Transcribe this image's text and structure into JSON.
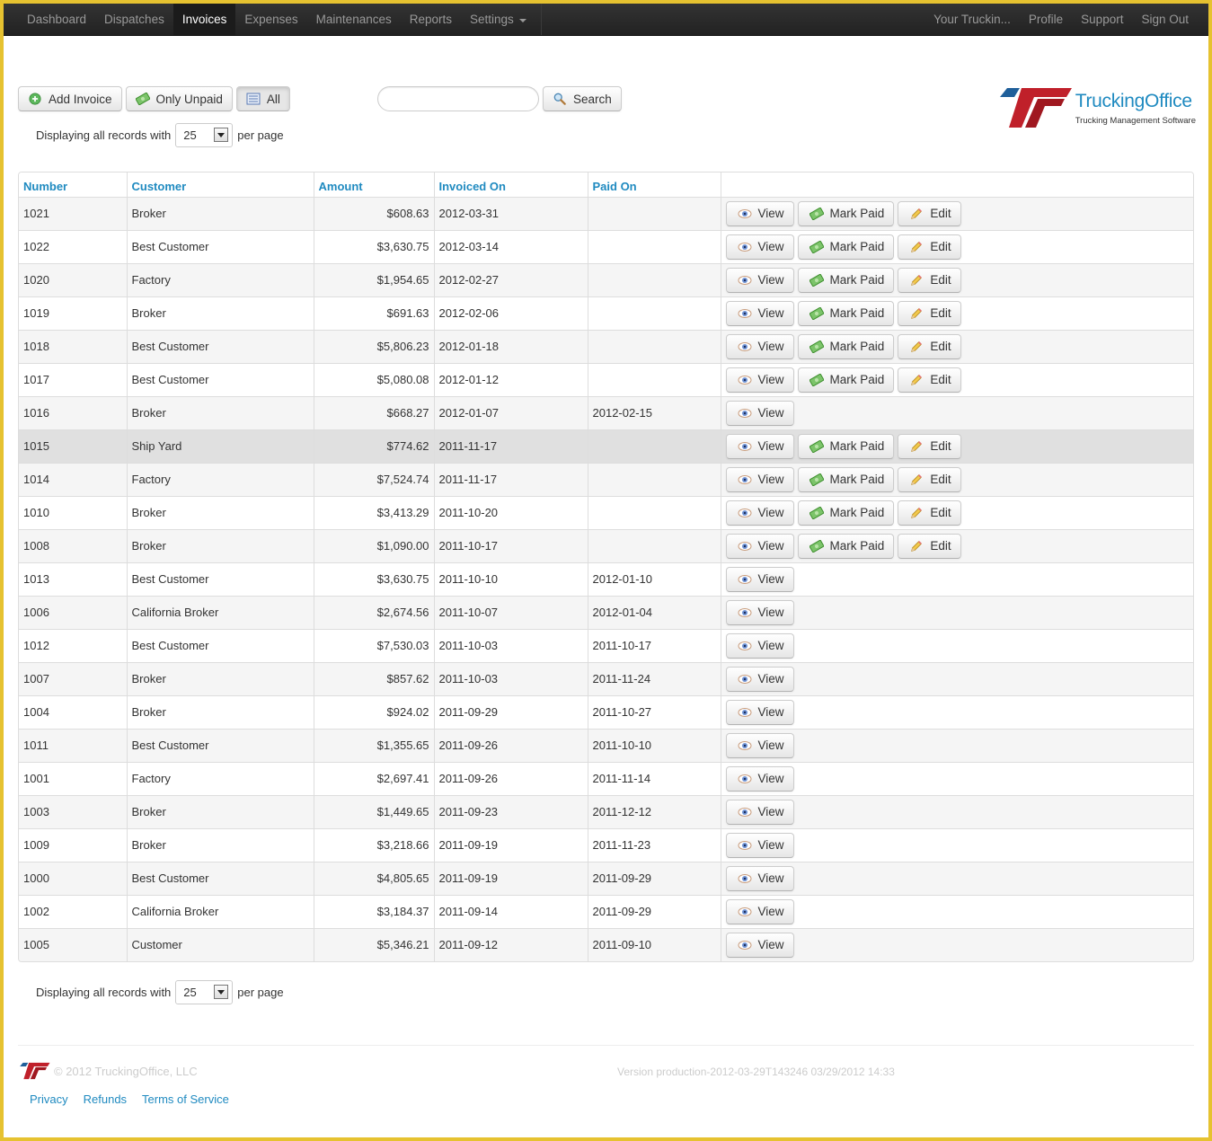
{
  "nav": {
    "left": [
      {
        "label": "Dashboard",
        "active": false
      },
      {
        "label": "Dispatches",
        "active": false
      },
      {
        "label": "Invoices",
        "active": true
      },
      {
        "label": "Expenses",
        "active": false
      },
      {
        "label": "Maintenances",
        "active": false
      },
      {
        "label": "Reports",
        "active": false
      },
      {
        "label": "Settings",
        "active": false,
        "dropdown": true
      }
    ],
    "right": [
      {
        "label": "Your Truckin..."
      },
      {
        "label": "Profile"
      },
      {
        "label": "Support"
      },
      {
        "label": "Sign Out"
      }
    ]
  },
  "toolbar": {
    "add_invoice_label": "Add Invoice",
    "only_unpaid_label": "Only Unpaid",
    "all_label": "All",
    "search_value": "",
    "search_label": "Search"
  },
  "logo": {
    "title": "TruckingOffice",
    "subtitle": "Trucking Management Software"
  },
  "pagination": {
    "prefix": "Displaying all records with",
    "per_page_value": "25",
    "suffix": "per page"
  },
  "table": {
    "columns": [
      "Number",
      "Customer",
      "Amount",
      "Invoiced On",
      "Paid On",
      ""
    ],
    "action_labels": {
      "view": "View",
      "mark_paid": "Mark Paid",
      "edit": "Edit"
    },
    "rows": [
      {
        "number": "1021",
        "customer": "Broker",
        "amount": "$608.63",
        "invoiced_on": "2012-03-31",
        "paid_on": "",
        "actions": [
          "view",
          "mark_paid",
          "edit"
        ]
      },
      {
        "number": "1022",
        "customer": "Best Customer",
        "amount": "$3,630.75",
        "invoiced_on": "2012-03-14",
        "paid_on": "",
        "actions": [
          "view",
          "mark_paid",
          "edit"
        ]
      },
      {
        "number": "1020",
        "customer": "Factory",
        "amount": "$1,954.65",
        "invoiced_on": "2012-02-27",
        "paid_on": "",
        "actions": [
          "view",
          "mark_paid",
          "edit"
        ]
      },
      {
        "number": "1019",
        "customer": "Broker",
        "amount": "$691.63",
        "invoiced_on": "2012-02-06",
        "paid_on": "",
        "actions": [
          "view",
          "mark_paid",
          "edit"
        ]
      },
      {
        "number": "1018",
        "customer": "Best Customer",
        "amount": "$5,806.23",
        "invoiced_on": "2012-01-18",
        "paid_on": "",
        "actions": [
          "view",
          "mark_paid",
          "edit"
        ]
      },
      {
        "number": "1017",
        "customer": "Best Customer",
        "amount": "$5,080.08",
        "invoiced_on": "2012-01-12",
        "paid_on": "",
        "actions": [
          "view",
          "mark_paid",
          "edit"
        ]
      },
      {
        "number": "1016",
        "customer": "Broker",
        "amount": "$668.27",
        "invoiced_on": "2012-01-07",
        "paid_on": "2012-02-15",
        "actions": [
          "view"
        ]
      },
      {
        "number": "1015",
        "customer": "Ship Yard",
        "amount": "$774.62",
        "invoiced_on": "2011-11-17",
        "paid_on": "",
        "actions": [
          "view",
          "mark_paid",
          "edit"
        ],
        "hover": true
      },
      {
        "number": "1014",
        "customer": "Factory",
        "amount": "$7,524.74",
        "invoiced_on": "2011-11-17",
        "paid_on": "",
        "actions": [
          "view",
          "mark_paid",
          "edit"
        ]
      },
      {
        "number": "1010",
        "customer": "Broker",
        "amount": "$3,413.29",
        "invoiced_on": "2011-10-20",
        "paid_on": "",
        "actions": [
          "view",
          "mark_paid",
          "edit"
        ]
      },
      {
        "number": "1008",
        "customer": "Broker",
        "amount": "$1,090.00",
        "invoiced_on": "2011-10-17",
        "paid_on": "",
        "actions": [
          "view",
          "mark_paid",
          "edit"
        ]
      },
      {
        "number": "1013",
        "customer": "Best Customer",
        "amount": "$3,630.75",
        "invoiced_on": "2011-10-10",
        "paid_on": "2012-01-10",
        "actions": [
          "view"
        ]
      },
      {
        "number": "1006",
        "customer": "California Broker",
        "amount": "$2,674.56",
        "invoiced_on": "2011-10-07",
        "paid_on": "2012-01-04",
        "actions": [
          "view"
        ]
      },
      {
        "number": "1012",
        "customer": "Best Customer",
        "amount": "$7,530.03",
        "invoiced_on": "2011-10-03",
        "paid_on": "2011-10-17",
        "actions": [
          "view"
        ]
      },
      {
        "number": "1007",
        "customer": "Broker",
        "amount": "$857.62",
        "invoiced_on": "2011-10-03",
        "paid_on": "2011-11-24",
        "actions": [
          "view"
        ]
      },
      {
        "number": "1004",
        "customer": "Broker",
        "amount": "$924.02",
        "invoiced_on": "2011-09-29",
        "paid_on": "2011-10-27",
        "actions": [
          "view"
        ]
      },
      {
        "number": "1011",
        "customer": "Best Customer",
        "amount": "$1,355.65",
        "invoiced_on": "2011-09-26",
        "paid_on": "2011-10-10",
        "actions": [
          "view"
        ]
      },
      {
        "number": "1001",
        "customer": "Factory",
        "amount": "$2,697.41",
        "invoiced_on": "2011-09-26",
        "paid_on": "2011-11-14",
        "actions": [
          "view"
        ]
      },
      {
        "number": "1003",
        "customer": "Broker",
        "amount": "$1,449.65",
        "invoiced_on": "2011-09-23",
        "paid_on": "2011-12-12",
        "actions": [
          "view"
        ]
      },
      {
        "number": "1009",
        "customer": "Broker",
        "amount": "$3,218.66",
        "invoiced_on": "2011-09-19",
        "paid_on": "2011-11-23",
        "actions": [
          "view"
        ]
      },
      {
        "number": "1000",
        "customer": "Best Customer",
        "amount": "$4,805.65",
        "invoiced_on": "2011-09-19",
        "paid_on": "2011-09-29",
        "actions": [
          "view"
        ]
      },
      {
        "number": "1002",
        "customer": "California Broker",
        "amount": "$3,184.37",
        "invoiced_on": "2011-09-14",
        "paid_on": "2011-09-29",
        "actions": [
          "view"
        ]
      },
      {
        "number": "1005",
        "customer": "Customer",
        "amount": "$5,346.21",
        "invoiced_on": "2011-09-12",
        "paid_on": "2011-09-10",
        "actions": [
          "view"
        ]
      }
    ]
  },
  "footer": {
    "copyright": "© 2012 TruckingOffice, LLC",
    "version": "Version production-2012-03-29T143246 03/29/2012 14:33",
    "links": [
      "Privacy",
      "Refunds",
      "Terms of Service"
    ]
  },
  "colors": {
    "accent": "#1f8ac0",
    "frame_border": "#e6c230",
    "navbar_bg": "#222222",
    "logo_red": "#c0202a",
    "logo_blue": "#1f5f9a"
  }
}
